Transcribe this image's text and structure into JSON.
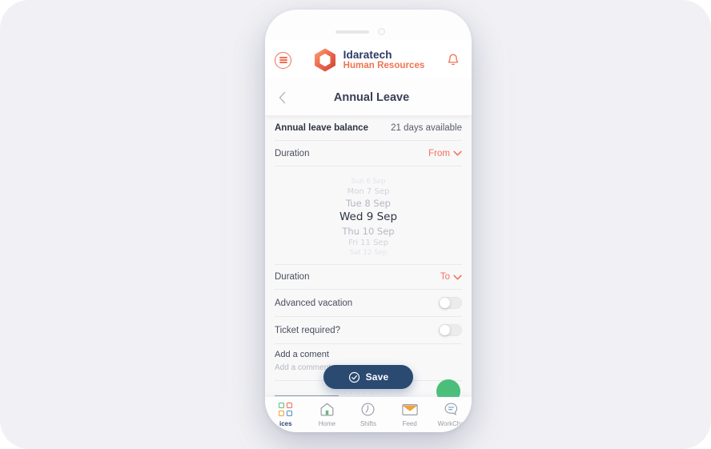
{
  "brand": {
    "name": "Idaratech",
    "subtitle": "Human Resources",
    "logo_icon": "hexagon-ring-logo",
    "name_color": "#2b3a64",
    "subtitle_color": "#ef7450"
  },
  "header": {
    "menu_icon": "hamburger-menu-icon",
    "bell_icon": "notification-bell-icon",
    "accent_color": "#ef6f52"
  },
  "title_bar": {
    "back_icon": "chevron-left-icon",
    "title": "Annual Leave"
  },
  "balance": {
    "label": "Annual leave balance",
    "value": "21 days available"
  },
  "duration_from": {
    "label": "Duration",
    "value": "From",
    "chevron_icon": "chevron-down-icon",
    "accent_color": "#f4715a"
  },
  "date_wheel": {
    "items": [
      "Sun 6 Sep",
      "Mon 7 Sep",
      "Tue 8 Sep",
      "Wed 9 Sep",
      "Thu 10 Sep",
      "Fri 11 Sep",
      "Sat 12 Sep"
    ],
    "selected_index": 3,
    "selected": "Wed 9 Sep"
  },
  "duration_to": {
    "label": "Duration",
    "value": "To",
    "chevron_icon": "chevron-down-icon"
  },
  "advanced_vacation": {
    "label": "Advanced vacation",
    "state": "off"
  },
  "ticket_required": {
    "label": "Ticket required?",
    "state": "off"
  },
  "comment": {
    "label": "Add a coment",
    "placeholder": "Add a comment...",
    "value": ""
  },
  "save": {
    "label": "Save",
    "icon": "check-circle-icon",
    "background_color": "#2b4a72"
  },
  "bottom_nav": {
    "items": [
      {
        "label": "ices",
        "icon": "services-grid-icon",
        "active": true
      },
      {
        "label": "Home",
        "icon": "home-icon",
        "active": false
      },
      {
        "label": "Shifts",
        "icon": "clock-icon",
        "active": false
      },
      {
        "label": "Feed",
        "icon": "envelope-icon",
        "active": false
      },
      {
        "label": "WorkCha",
        "icon": "chat-bubble-icon",
        "active": false
      }
    ]
  }
}
